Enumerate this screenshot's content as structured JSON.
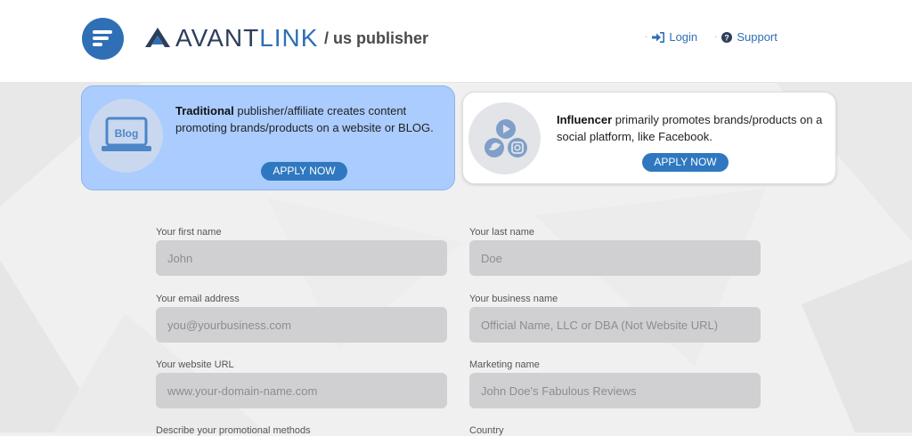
{
  "header": {
    "logo_avant": "AVANT",
    "logo_link": "LINK",
    "subtitle": "/ us publisher",
    "nav": {
      "login": "Login",
      "support": "Support"
    }
  },
  "cards": {
    "traditional": {
      "icon_label": "Blog",
      "title": "Traditional",
      "description": " publisher/affiliate creates content promoting brands/products on a website or BLOG.",
      "button": "APPLY NOW"
    },
    "influencer": {
      "title": "Influencer",
      "description": " primarily promotes brands/products on a social platform, like Facebook.",
      "button": "APPLY NOW"
    }
  },
  "form": {
    "first_name": {
      "label": "Your first name",
      "placeholder": "John"
    },
    "last_name": {
      "label": "Your last name",
      "placeholder": "Doe"
    },
    "email": {
      "label": "Your email address",
      "placeholder": "you@yourbusiness.com"
    },
    "business_name": {
      "label": "Your business name",
      "placeholder": "Official Name, LLC or DBA (Not Website URL)"
    },
    "website_url": {
      "label": "Your website URL",
      "placeholder": "www.your-domain-name.com"
    },
    "marketing_name": {
      "label": "Marketing name",
      "placeholder": "John Doe's Fabulous Reviews"
    },
    "promotional_methods": {
      "label": "Describe your promotional methods"
    },
    "country": {
      "label": "Country"
    }
  },
  "colors": {
    "brand_blue": "#2f6fb5",
    "card_selected": "#aaccff",
    "button": "#2f78c0"
  }
}
